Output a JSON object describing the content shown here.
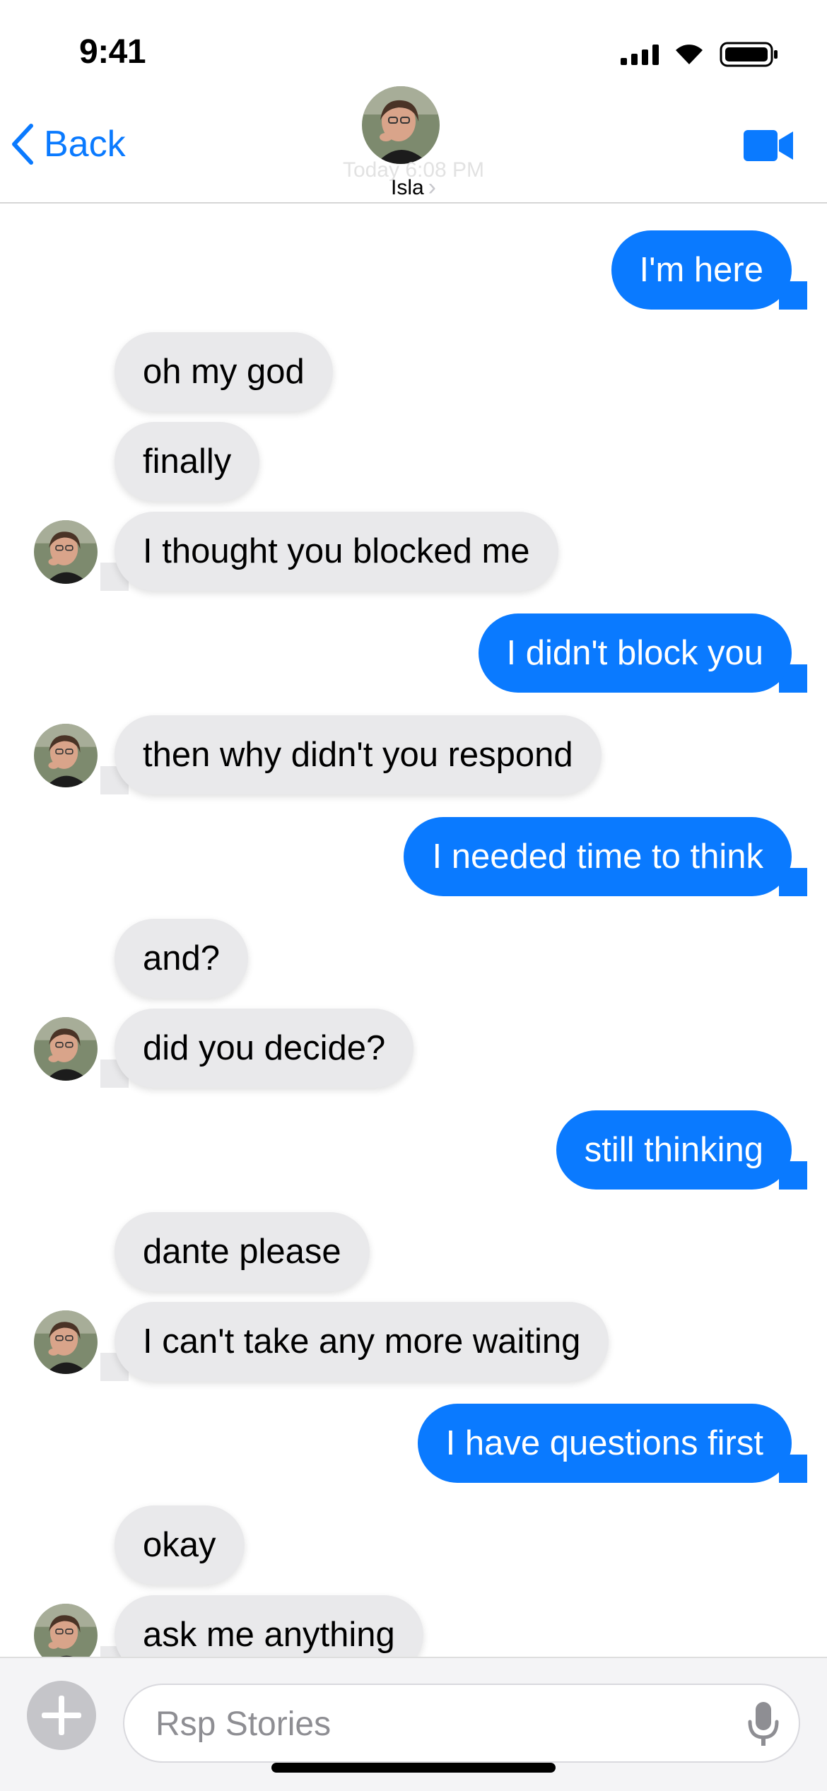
{
  "status_bar": {
    "time": "9:41"
  },
  "header": {
    "back_label": "Back",
    "timestamp": "Today 6:08 PM",
    "contact_name": "Isla"
  },
  "messages": [
    {
      "side": "sent",
      "text": "I'm here"
    },
    {
      "side": "received",
      "text": "oh my god"
    },
    {
      "side": "received",
      "text": "finally"
    },
    {
      "side": "received",
      "text": "I thought you blocked me"
    },
    {
      "side": "sent",
      "text": "I didn't block you"
    },
    {
      "side": "received",
      "text": "then why didn't you respond"
    },
    {
      "side": "sent",
      "text": "I needed time to think"
    },
    {
      "side": "received",
      "text": "and?"
    },
    {
      "side": "received",
      "text": "did you decide?"
    },
    {
      "side": "sent",
      "text": "still thinking"
    },
    {
      "side": "received",
      "text": "dante please"
    },
    {
      "side": "received",
      "text": "I can't take any more waiting"
    },
    {
      "side": "sent",
      "text": "I have questions first"
    },
    {
      "side": "received",
      "text": "okay"
    },
    {
      "side": "received",
      "text": "ask me anything"
    }
  ],
  "input": {
    "placeholder": "Rsp Stories"
  },
  "icons": {
    "back": "chevron-left-icon",
    "video": "video-camera-icon",
    "add": "plus-icon",
    "mic": "microphone-icon"
  },
  "colors": {
    "accent": "#0a7aff",
    "received_bubble": "#e9e9eb",
    "sent_text": "#ffffff"
  }
}
